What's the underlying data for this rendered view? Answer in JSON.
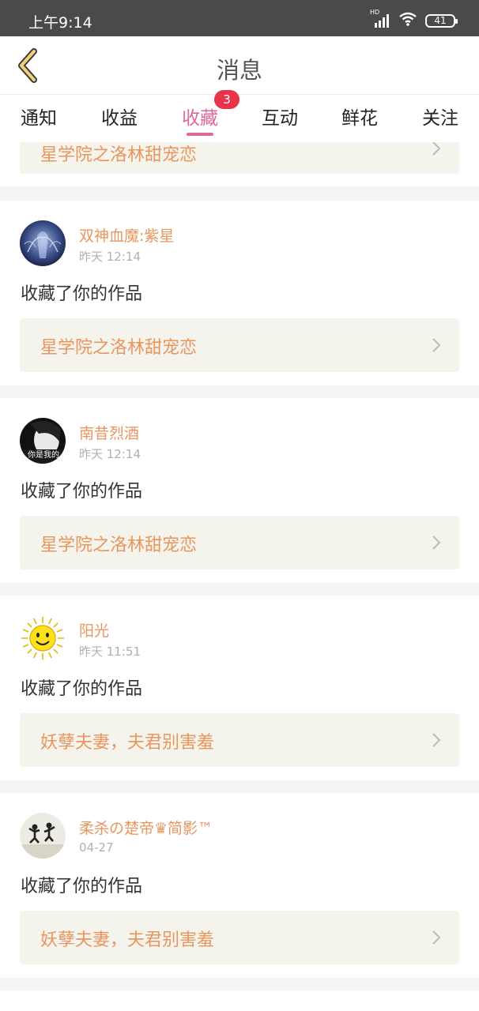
{
  "status_bar": {
    "time": "上午9:14",
    "battery": "41",
    "network_label": "HD"
  },
  "header": {
    "title": "消息"
  },
  "tabs": [
    {
      "label": "通知",
      "active": false
    },
    {
      "label": "收益",
      "active": false
    },
    {
      "label": "收藏",
      "active": true,
      "badge": "3"
    },
    {
      "label": "互动",
      "active": false
    },
    {
      "label": "鲜花",
      "active": false
    },
    {
      "label": "关注",
      "active": false
    }
  ],
  "colors": {
    "accent_pink": "#e0679b",
    "badge_red": "#e8344a",
    "username_orange": "#e8965f",
    "work_box_bg": "#f5f4ec"
  },
  "partial_card": {
    "work_title": "星学院之洛林甜宠恋"
  },
  "notifications": [
    {
      "username": "双神血魔:紫星",
      "time": "昨天 12:14",
      "action": "收藏了你的作品",
      "work_title": "星学院之洛林甜宠恋",
      "avatar": "dark-blue-angel-avatar"
    },
    {
      "username": "南昔烈酒",
      "time": "昨天 12:14",
      "action": "收藏了你的作品",
      "work_title": "星学院之洛林甜宠恋",
      "avatar": "black-white-portrait-avatar",
      "avatar_caption": "你是我的"
    },
    {
      "username": "阳光",
      "time": "昨天 11:51",
      "action": "收藏了你的作品",
      "work_title": "妖孽夫妻，夫君别害羞",
      "avatar": "smiling-sun-avatar"
    },
    {
      "username": "柔杀の楚帝♛简影™",
      "time": "04-27",
      "action": "收藏了你的作品",
      "work_title": "妖孽夫妻，夫君别害羞",
      "avatar": "jumping-couple-avatar"
    }
  ]
}
